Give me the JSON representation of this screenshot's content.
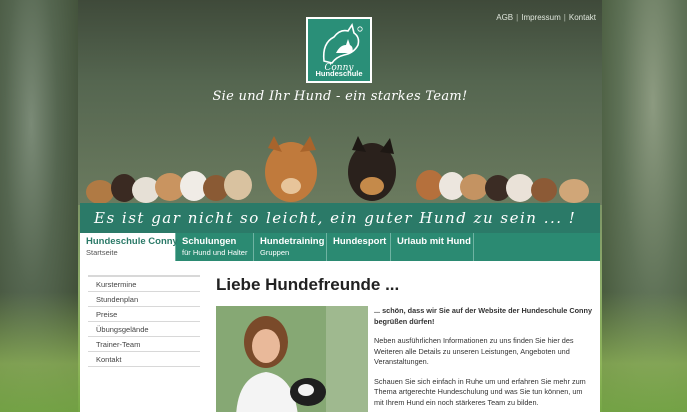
{
  "toplinks": [
    "AGB",
    "Impressum",
    "Kontakt"
  ],
  "logo": {
    "name": "Conny",
    "sub": "Hundeschule"
  },
  "tagline": "Sie und Ihr Hund - ein starkes Team!",
  "banner": "Es ist gar nicht so leicht, ein guter Hund zu sein ... !",
  "nav": [
    {
      "title": "Hundeschule Conny",
      "sub": "Startseite",
      "active": true
    },
    {
      "title": "Schulungen",
      "sub": "für Hund und Halter",
      "active": false
    },
    {
      "title": "Hundetraining",
      "sub": "Gruppen",
      "active": false
    },
    {
      "title": "Hundesport",
      "sub": "",
      "active": false
    },
    {
      "title": "Urlaub mit Hund",
      "sub": "",
      "active": false
    }
  ],
  "sidebar": [
    "Kurstermine",
    "Stundenplan",
    "Preise",
    "Übungsgelände",
    "Trainer-Team",
    "Kontakt"
  ],
  "main": {
    "title": "Liebe Hundefreunde ...",
    "intro": "... schön, dass wir Sie auf der Website der Hundeschule Conny begrüßen dürfen!",
    "p2": "Neben ausführlichen Informationen zu uns finden Sie hier des Weiteren alle Details zu unseren Leistungen, Angeboten und Veranstaltungen.",
    "p3": "Schauen Sie sich einfach in Ruhe um und erfahren Sie mehr zum Thema artgerechte Hundeschulung und was Sie tun können, um mit Ihrem Hund ein noch stärkeres Team zu bilden."
  },
  "colors": {
    "brand": "#2b8a72",
    "banner": "#2b7a68",
    "logo": "#2a8f78"
  }
}
